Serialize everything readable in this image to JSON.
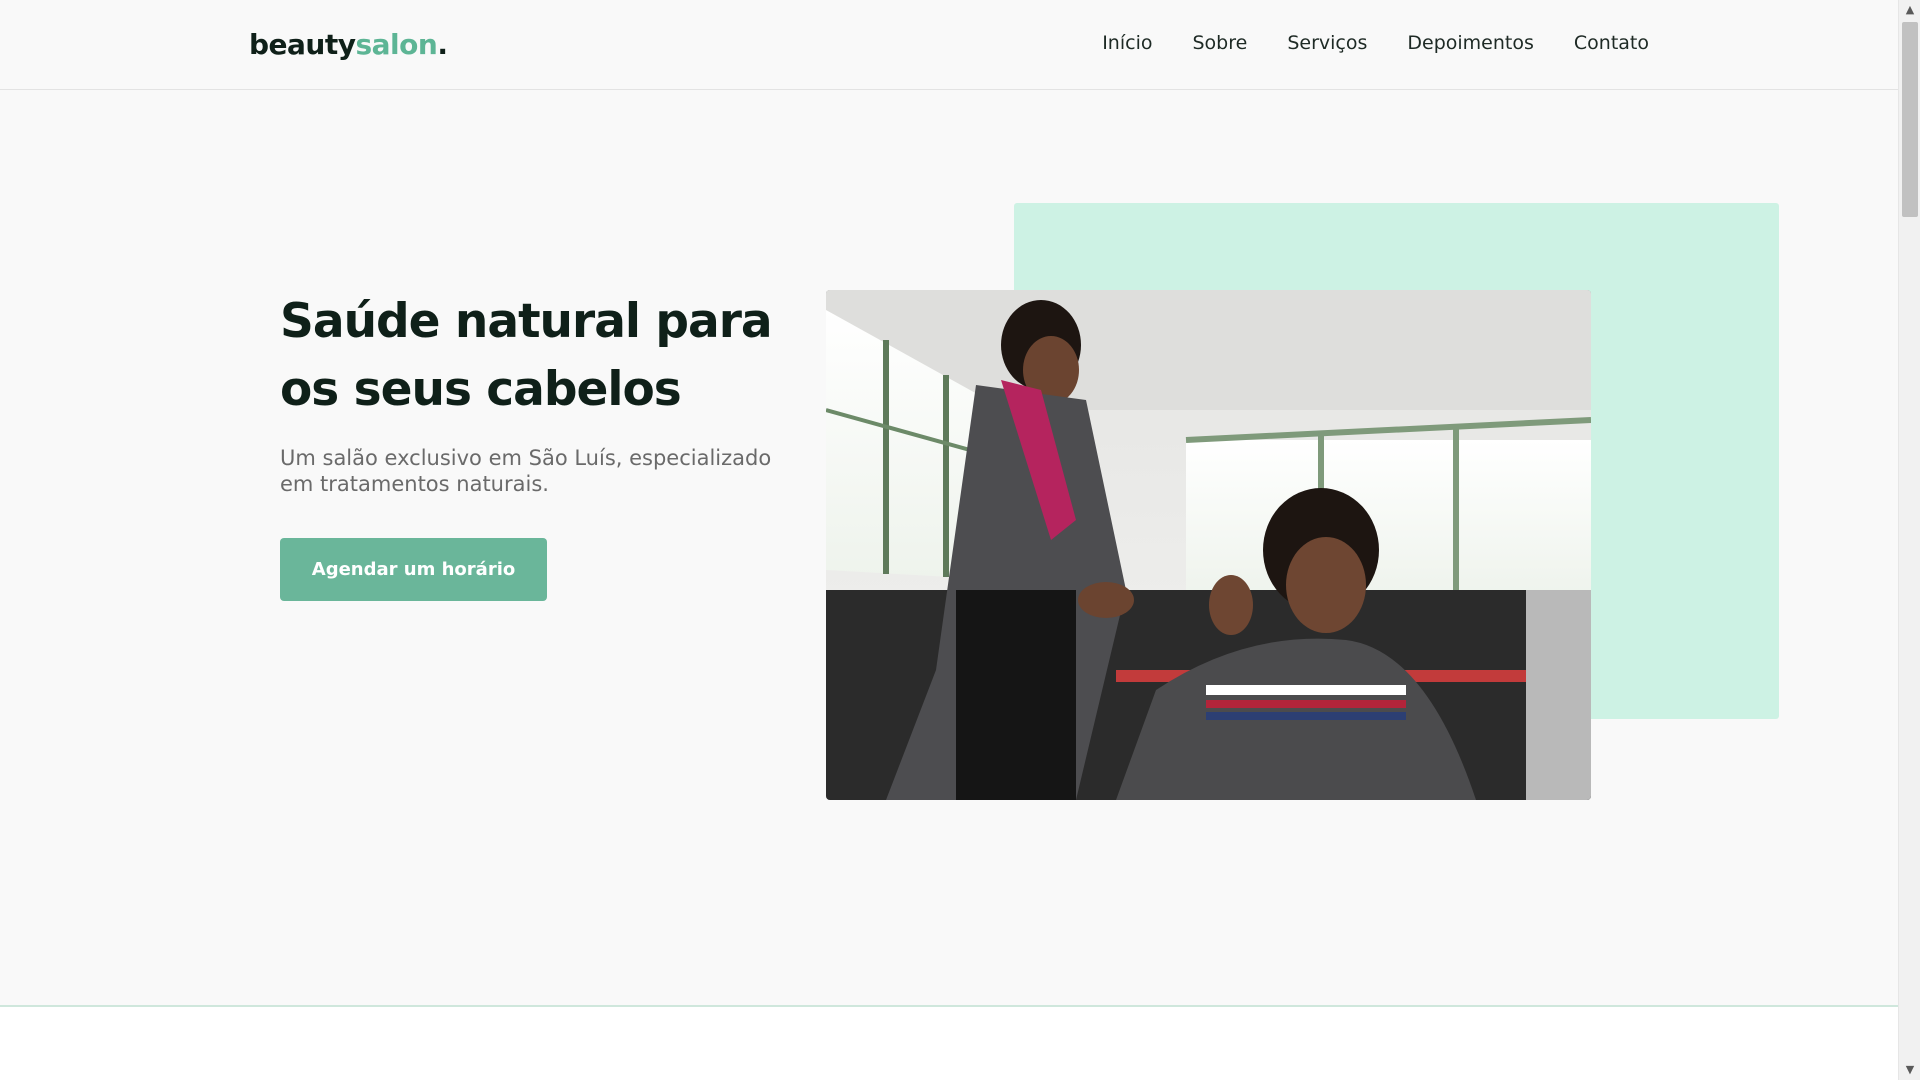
{
  "header": {
    "logo_main": "beauty",
    "logo_accent": "salon",
    "logo_dot": ".",
    "nav": [
      "Início",
      "Sobre",
      "Serviços",
      "Depoimentos",
      "Contato"
    ]
  },
  "hero": {
    "title": "Saúde natural para os seus cabelos",
    "subtitle": "Um salão exclusivo em São Luís, especializado em tratamentos naturais.",
    "cta_label": "Agendar um horário",
    "image_icon": "salon-photo"
  },
  "colors": {
    "accent": "#5db595",
    "button": "#6ab69a",
    "mint_block": "#cdf2e4",
    "heading": "#0f2019"
  },
  "scrollbar": {
    "up_icon": "chevron-up-icon",
    "down_icon": "chevron-down-icon"
  }
}
